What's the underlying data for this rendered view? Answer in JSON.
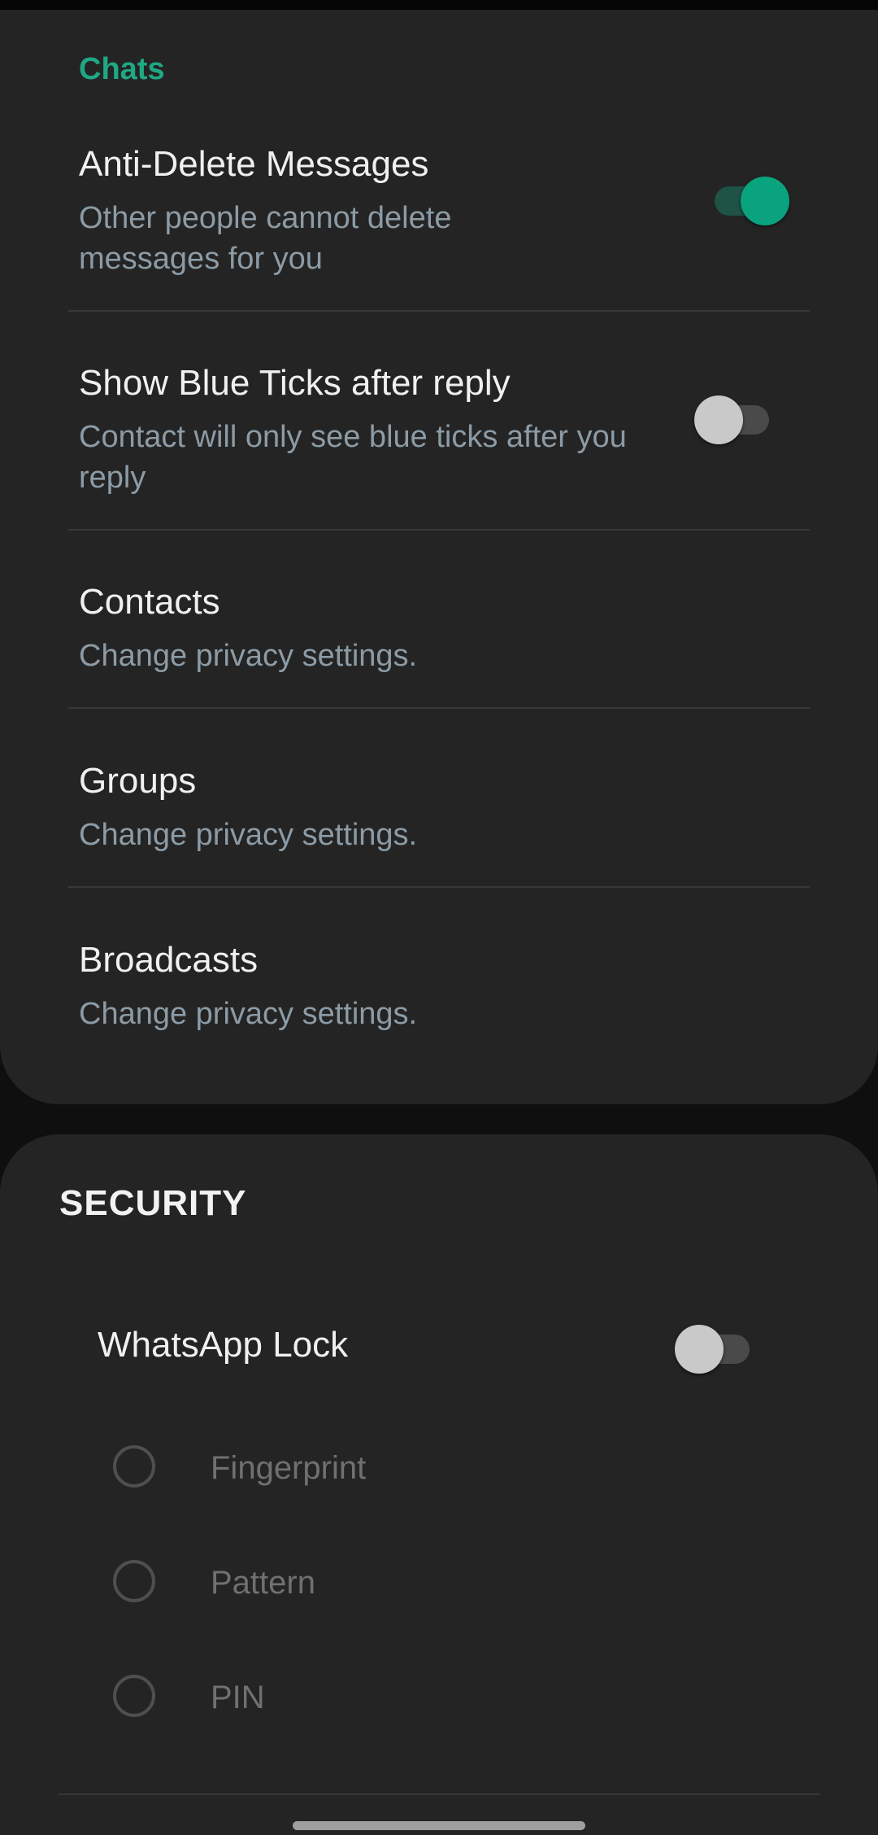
{
  "chats_section": {
    "header": "Chats",
    "items": [
      {
        "title": "Anti-Delete Messages",
        "summary": "Other people cannot delete messages for you",
        "toggle": "on"
      },
      {
        "title": "Show Blue Ticks after reply",
        "summary": "Contact will only see blue ticks after you reply",
        "toggle": "off"
      },
      {
        "title": "Contacts",
        "summary": "Change privacy settings."
      },
      {
        "title": "Groups",
        "summary": "Change privacy settings."
      },
      {
        "title": "Broadcasts",
        "summary": "Change privacy settings."
      }
    ]
  },
  "security_section": {
    "header": "SECURITY",
    "lock": {
      "title": "WhatsApp Lock",
      "toggle": "off"
    },
    "options": [
      {
        "label": "Fingerprint",
        "selected": false
      },
      {
        "label": "Pattern",
        "selected": false
      },
      {
        "label": "PIN",
        "selected": false
      }
    ]
  },
  "colors": {
    "accent": "#09a37e",
    "header_green": "#1fa884",
    "card_bg": "#242424",
    "summary_text": "#8c9ba5",
    "disabled_text": "#707070"
  }
}
